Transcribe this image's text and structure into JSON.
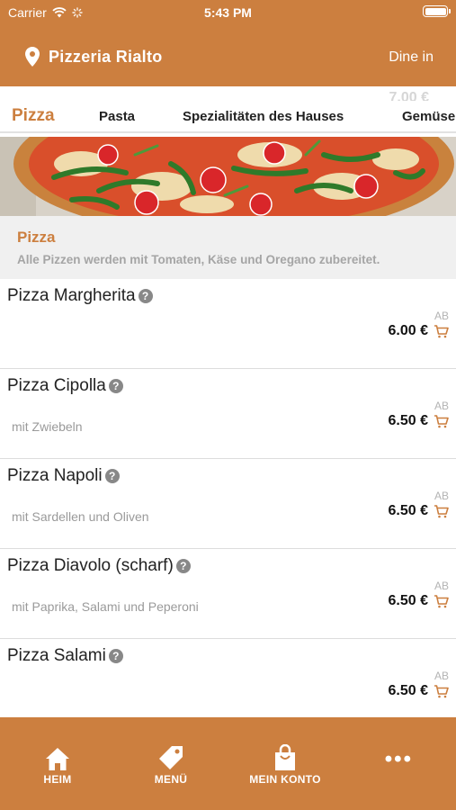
{
  "status_bar": {
    "carrier": "Carrier",
    "time": "5:43 PM"
  },
  "header": {
    "title": "Pizzeria Rialto",
    "mode": "Dine in"
  },
  "ghost_row": {
    "price": "7.00 €"
  },
  "tabs": [
    {
      "label": "Pizza",
      "active": true
    },
    {
      "label": "Pasta",
      "active": false
    },
    {
      "label": "Spezialitäten des Hauses",
      "active": false
    },
    {
      "label": "Gemüse",
      "active": false
    }
  ],
  "section": {
    "title": "Pizza",
    "description": "Alle Pizzen werden mit Tomaten, Käse und Oregano zubereitet."
  },
  "items": [
    {
      "name": "Pizza Margherita",
      "description": "",
      "price_prefix": "AB",
      "price": "6.00 €"
    },
    {
      "name": "Pizza Cipolla",
      "description": "mit Zwiebeln",
      "price_prefix": "AB",
      "price": "6.50 €"
    },
    {
      "name": "Pizza Napoli",
      "description": "mit Sardellen und Oliven",
      "price_prefix": "AB",
      "price": "6.50 €"
    },
    {
      "name": "Pizza Diavolo (scharf)",
      "description": "mit Paprika, Salami und Peperoni",
      "price_prefix": "AB",
      "price": "6.50 €"
    },
    {
      "name": "Pizza Salami",
      "description": "",
      "price_prefix": "AB",
      "price": "6.50 €"
    }
  ],
  "bottom_nav": [
    {
      "label": "HEIM",
      "icon": "home-icon"
    },
    {
      "label": "MENÜ",
      "icon": "tag-icon"
    },
    {
      "label": "MEIN KONTO",
      "icon": "shopping-bag-icon"
    },
    {
      "label": "",
      "icon": "more-icon"
    }
  ],
  "colors": {
    "brand": "#cc7f3f",
    "section_bg": "#f0f0f0",
    "text": "#222222",
    "muted": "#9a9a9a"
  }
}
